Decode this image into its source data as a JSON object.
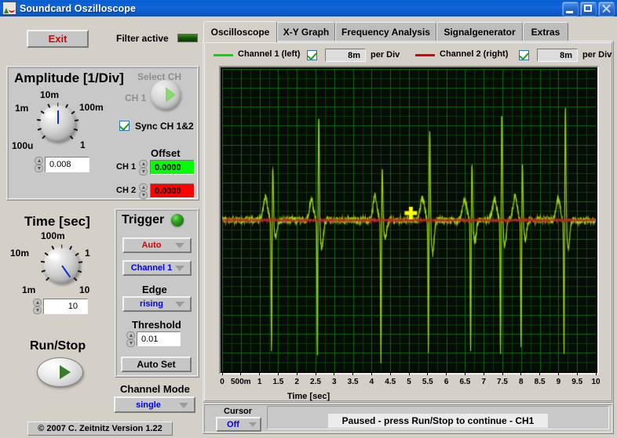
{
  "window": {
    "title": "Soundcard Oszilloscope",
    "buttons": {
      "minimize": "minimize",
      "maximize": "maximize",
      "close": "close"
    }
  },
  "toolbar": {
    "exit_label": "Exit",
    "filter_label": "Filter active",
    "filter_led_color": "#1f5a10"
  },
  "tabs": [
    {
      "label": "Oscilloscope",
      "active": true
    },
    {
      "label": "X-Y Graph",
      "active": false
    },
    {
      "label": "Frequency Analysis",
      "active": false
    },
    {
      "label": "Signalgenerator",
      "active": false
    },
    {
      "label": "Extras",
      "active": false
    }
  ],
  "channels": [
    {
      "name": "Channel 1 (left)",
      "color": "#00e000",
      "enabled": true,
      "scale": "8m",
      "unit": "per Div"
    },
    {
      "name": "Channel 2 (right)",
      "color": "#e00000",
      "enabled": true,
      "scale": "8m",
      "unit": "per Div"
    }
  ],
  "amplitude": {
    "title": "Amplitude [1/Div]",
    "knob_labels": [
      "100u",
      "1m",
      "10m",
      "100m",
      "1"
    ],
    "value": "0.008",
    "select_ch_label": "Select CH",
    "select_ch_value": "CH 1",
    "sync_label": "Sync CH 1&2",
    "sync_checked": true,
    "offset_label": "Offset",
    "offsets": [
      {
        "label": "CH 1",
        "value": "0.0000",
        "color": "#00ff00"
      },
      {
        "label": "CH 2",
        "value": "0.0000",
        "color": "#ff0000"
      }
    ]
  },
  "time": {
    "title": "Time [sec]",
    "knob_labels": [
      "1m",
      "10m",
      "100m",
      "1",
      "10"
    ],
    "value": "10"
  },
  "trigger": {
    "title": "Trigger",
    "led_on": true,
    "mode": "Auto",
    "mode_color": "#dd0000",
    "source": "Channel 1",
    "edge_label": "Edge",
    "edge": "rising",
    "threshold_label": "Threshold",
    "threshold": "0.01",
    "auto_set_label": "Auto Set"
  },
  "run_stop": {
    "label": "Run/Stop"
  },
  "channel_mode": {
    "label": "Channel Mode",
    "value": "single"
  },
  "copyright": "© 2007   C. Zeitnitz Version 1.22",
  "cursor": {
    "label": "Cursor",
    "value": "Off"
  },
  "status": {
    "text": "Paused - press Run/Stop to continue - CH1"
  },
  "chart_data": {
    "type": "line",
    "title": "",
    "xlabel": "Time [sec]",
    "ylabel": "",
    "xlim": [
      0,
      10
    ],
    "ylim": [
      -0.032,
      0.032
    ],
    "grid": true,
    "background": "#060c06",
    "grid_color": "#0f6a0f",
    "minor_grid_color": "#0a3a0a",
    "xticks": [
      0,
      0.5,
      1,
      1.5,
      2,
      2.5,
      3,
      3.5,
      4,
      4.5,
      5,
      5.5,
      6,
      6.5,
      7,
      7.5,
      8,
      8.5,
      9,
      9.5,
      10
    ],
    "xticklabels": [
      "0",
      "500m",
      "1",
      "1.5",
      "2",
      "2.5",
      "3",
      "3.5",
      "4",
      "4.5",
      "5",
      "5.5",
      "6",
      "6.5",
      "7",
      "7.5",
      "8",
      "8.5",
      "9",
      "9.5",
      "10"
    ],
    "divisions_x": 20,
    "divisions_y": 8,
    "volts_per_div": 0.008,
    "cursor_marker": {
      "x": 5.05,
      "y": 0.0015,
      "color": "#ffff00",
      "shape": "cross"
    },
    "series": [
      {
        "name": "Channel 1 (left)",
        "color": "#9dd21c",
        "description": "ECG-like heartbeat trace, baseline near 0 with periodic QRS complexes",
        "baseline": 0.0,
        "noise_amplitude": 0.0012,
        "beats": [
          {
            "t": 1.32,
            "p_amp": 0.0052,
            "q_amp": -0.0285,
            "r_amp": 0.0115,
            "s_amp": -0.0035
          },
          {
            "t": 2.55,
            "p_amp": 0.0045,
            "q_amp": -0.03,
            "r_amp": 0.023,
            "s_amp": -0.006
          },
          {
            "t": 4.25,
            "p_amp": 0.005,
            "q_amp": -0.031,
            "r_amp": 0.0115,
            "s_amp": -0.004
          },
          {
            "t": 5.52,
            "p_amp": 0.0048,
            "q_amp": -0.03,
            "r_amp": 0.0205,
            "s_amp": -0.007
          },
          {
            "t": 6.65,
            "p_amp": 0.0046,
            "q_amp": -0.029,
            "r_amp": 0.013,
            "s_amp": -0.0045
          },
          {
            "t": 7.45,
            "p_amp": 0.0044,
            "q_amp": -0.03,
            "r_amp": 0.0235,
            "s_amp": -0.0055
          },
          {
            "t": 8.0,
            "p_amp": 0.005,
            "q_amp": -0.028,
            "r_amp": 0.012,
            "s_amp": -0.004
          },
          {
            "t": 9.15,
            "p_amp": 0.0046,
            "q_amp": -0.03,
            "r_amp": 0.0245,
            "s_amp": -0.006
          }
        ]
      },
      {
        "name": "Channel 2 (right)",
        "color": "#b03020",
        "description": "Flat line at zero, mostly hidden behind channel 1",
        "baseline": 0.0,
        "noise_amplitude": 0.0004,
        "beats": []
      }
    ]
  }
}
